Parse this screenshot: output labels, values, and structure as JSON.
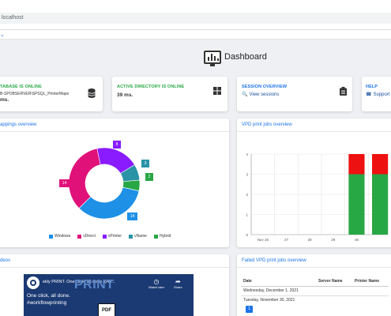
{
  "browser": {
    "url": "localhost"
  },
  "dashboard": {
    "title": "Dashboard"
  },
  "cards": {
    "database": {
      "heading": "TABASE IS ONLINE",
      "server": "B-SPOBSERVER\\SPSQL_PrinterMaps",
      "latency": "ms."
    },
    "ad": {
      "heading": "ACTIVE DIRECTORY IS ONLINE",
      "latency": "39 ms."
    },
    "session": {
      "heading": "SESSION OVERVIEW",
      "link": "View sessions"
    },
    "help": {
      "heading": "HELP",
      "link": "Support"
    }
  },
  "mappings": {
    "title": "appings overview",
    "legend": [
      {
        "label": "Windows",
        "color": "#1e90e6"
      },
      {
        "label": "vDirect",
        "color": "#e0127a"
      },
      {
        "label": "vPrinter",
        "color": "#8a1bff"
      },
      {
        "label": "vName",
        "color": "#2a93a6"
      },
      {
        "label": "Hybrid",
        "color": "#28a745"
      }
    ],
    "labels": {
      "windows": "14",
      "vdirect": "14",
      "vprinter": "8",
      "vname": "3",
      "hybrid": "2"
    }
  },
  "chart_data": {
    "type": "bar",
    "title": "VPD print jobs overview",
    "categories": [
      "Nov 26",
      "27",
      "28",
      "29",
      "30",
      ""
    ],
    "series": [
      {
        "values": [
          0,
          0,
          0,
          0,
          3,
          3
        ],
        "color": "#28a745"
      },
      {
        "values": [
          0,
          0,
          0,
          0,
          1,
          1
        ],
        "color": "#e11"
      }
    ],
    "yticks": [
      "0",
      "1",
      "2",
      "3",
      "4"
    ],
    "ylim": [
      0,
      4
    ],
    "grid": true
  },
  "videos": {
    "title": "deos"
  },
  "video": {
    "yt_title": "ekly PRINT. One click, all done. (Ho...",
    "line1": "One click, all done.",
    "line2": "#workflowprinting",
    "brand": "PRINT",
    "pdf": "PDF",
    "watch_later": "Watch later",
    "share": "Share"
  },
  "failed": {
    "title": "Failed VPD print jobs overview",
    "columns": [
      "Date",
      "Server Name",
      "Printer Name"
    ],
    "rows": [
      [
        "Wednesday, December 1, 2021",
        "",
        ""
      ],
      [
        "Tuesday, November 30, 2021",
        "",
        ""
      ]
    ],
    "page": "1"
  }
}
